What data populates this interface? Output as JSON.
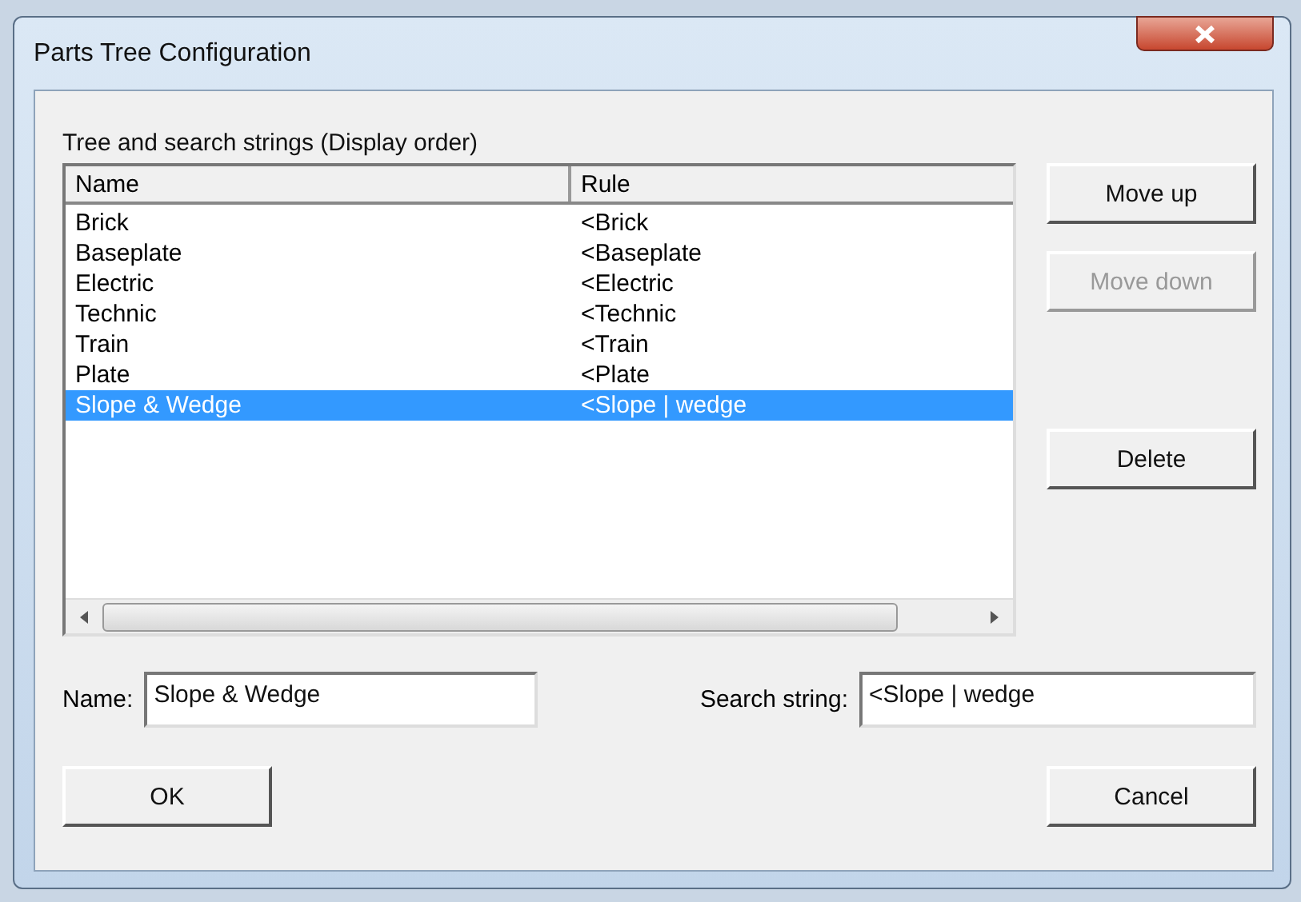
{
  "window": {
    "title": "Parts Tree Configuration"
  },
  "list_label": "Tree and search strings (Display order)",
  "table": {
    "columns": [
      "Name",
      "Rule"
    ],
    "rows": [
      {
        "name": "Brick",
        "rule": "<Brick",
        "selected": false
      },
      {
        "name": "Baseplate",
        "rule": "<Baseplate",
        "selected": false
      },
      {
        "name": "Electric",
        "rule": "<Electric",
        "selected": false
      },
      {
        "name": "Technic",
        "rule": "<Technic",
        "selected": false
      },
      {
        "name": "Train",
        "rule": "<Train",
        "selected": false
      },
      {
        "name": "Plate",
        "rule": "<Plate",
        "selected": false
      },
      {
        "name": "Slope & Wedge",
        "rule": "<Slope | wedge",
        "selected": true
      }
    ]
  },
  "side_buttons": [
    {
      "label": "Move up",
      "disabled": false
    },
    {
      "label": "Move down",
      "disabled": true
    },
    {
      "label": "Delete",
      "disabled": false
    }
  ],
  "fields": [
    {
      "label": "Name:",
      "value": "Slope & Wedge"
    },
    {
      "label": "Search string:",
      "value": "<Slope | wedge"
    }
  ],
  "buttons": [
    {
      "label": "OK"
    },
    {
      "label": "Cancel"
    }
  ]
}
